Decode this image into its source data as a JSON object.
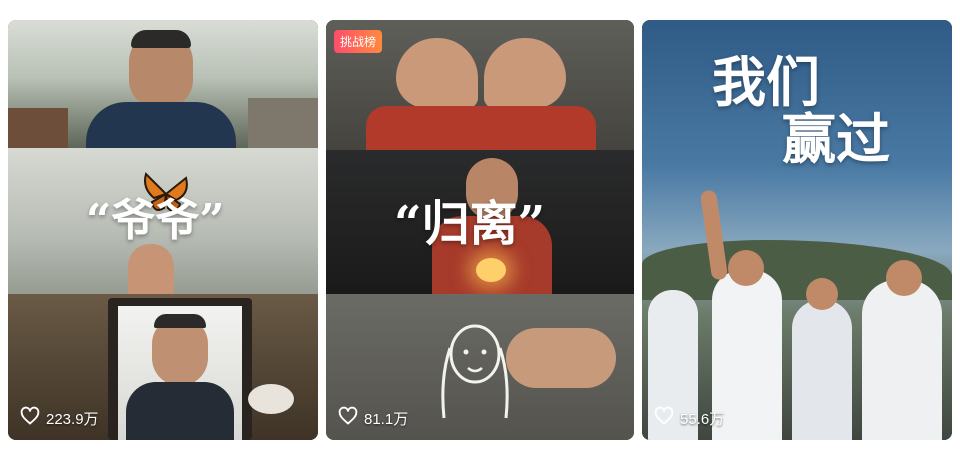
{
  "feed": {
    "cards": [
      {
        "title": "“爷爷”",
        "likes": "223.9万",
        "icon": "heart-outline-icon"
      },
      {
        "title": "“归离”",
        "likes": "81.1万",
        "badge": "挑战榜",
        "icon": "heart-outline-icon"
      },
      {
        "title_line1": "我们",
        "title_line2": "赢过",
        "likes": "55.6万",
        "icon": "heart-outline-icon"
      }
    ]
  },
  "colors": {
    "badge_start": "#ff4d6d",
    "badge_end": "#ff8a3d",
    "text": "#ffffff"
  }
}
